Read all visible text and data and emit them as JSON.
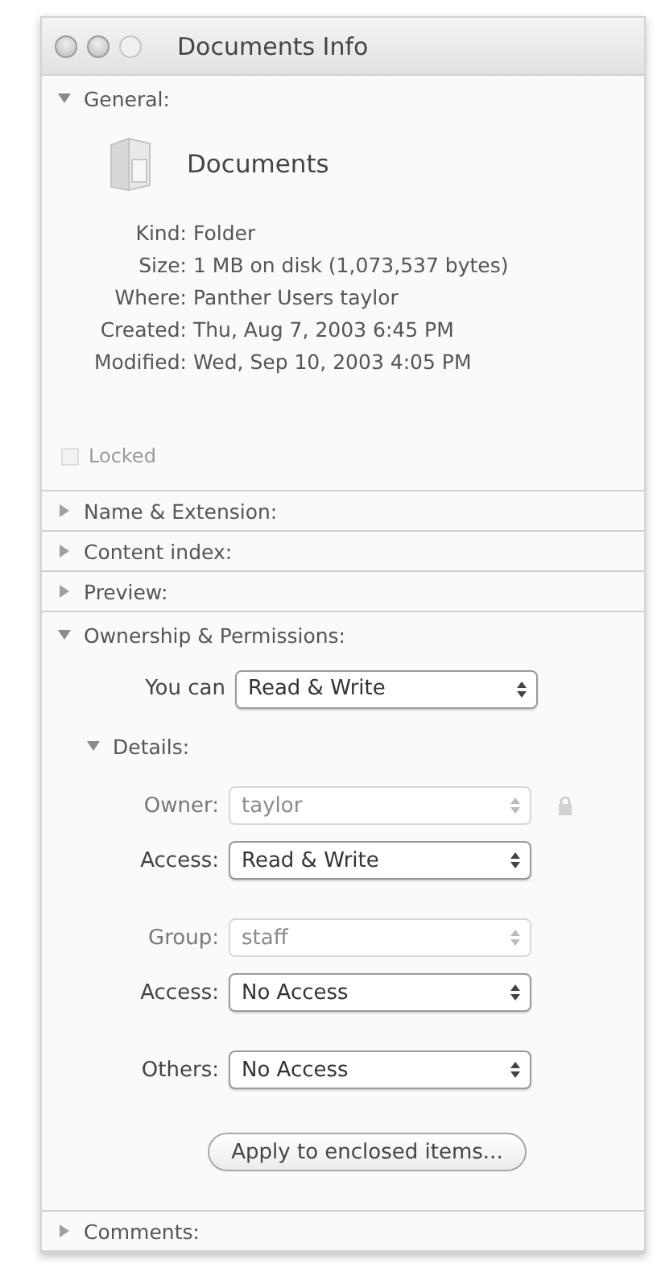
{
  "window": {
    "title": "Documents Info"
  },
  "sections": [
    {
      "kind": "general",
      "title": "General:",
      "expanded": true,
      "name": "Documents",
      "info": [
        {
          "label": "Kind:",
          "value": "Folder"
        },
        {
          "label": "Size:",
          "value": "1 MB on disk (1,073,537 bytes)"
        },
        {
          "label": "Where:",
          "value": "Panther Users taylor"
        },
        {
          "label": "Created:",
          "value": "Thu, Aug 7, 2003 6:45 PM"
        },
        {
          "label": "Modified:",
          "value": "Wed, Sep 10, 2003 4:05 PM"
        }
      ],
      "locked": {
        "label": "Locked",
        "checked": false,
        "disabled": true
      }
    },
    {
      "title": "Name & Extension:",
      "expanded": false
    },
    {
      "title": "Content index:",
      "expanded": false
    },
    {
      "title": "Preview:",
      "expanded": false
    },
    {
      "kind": "ownership",
      "title": "Ownership & Permissions:",
      "expanded": true,
      "you_can": {
        "label": "You can",
        "value": "Read & Write"
      },
      "details": {
        "title": "Details:",
        "expanded": true,
        "groups": [
          [
            {
              "label": "Owner:",
              "value": "taylor",
              "disabled": true,
              "lock": true
            },
            {
              "label": "Access:",
              "value": "Read & Write",
              "disabled": false,
              "lock": false
            }
          ],
          [
            {
              "label": "Group:",
              "value": "staff",
              "disabled": true,
              "lock": false
            },
            {
              "label": "Access:",
              "value": "No Access",
              "disabled": false,
              "lock": false
            }
          ],
          [
            {
              "label": "Others:",
              "value": "No Access",
              "disabled": false,
              "lock": false
            }
          ]
        ]
      },
      "button": "Apply to enclosed items..."
    },
    {
      "title": "Comments:",
      "expanded": false
    }
  ]
}
